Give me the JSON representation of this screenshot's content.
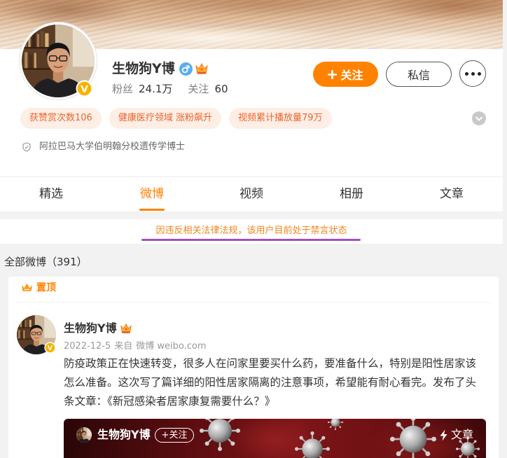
{
  "colors": {
    "accent": "#ff8200",
    "tag_bg": "#fdeee6",
    "tag_text": "#e9662c",
    "notice_text": "#f0861e",
    "annotation": "#a24fbf",
    "male_icon": "#5aaef0",
    "verified": "#f6b400",
    "page_bg": "#f2f2f2"
  },
  "profile": {
    "name": "生物狗Y博",
    "gender_icon": "male-icon",
    "member_icon": "crown-icon",
    "verified_icon": "verified-v-icon",
    "fans_label": "粉丝",
    "fans_count": "24.1万",
    "following_label": "关注",
    "following_count": "60",
    "tags": [
      "获赞赏次数106",
      "健康医疗领域 涨粉飙升",
      "视频累计播放量79万"
    ],
    "expand_icon": "chevron-down-icon",
    "description_icon": "shield-icon",
    "description": "阿拉巴马大学伯明翰分校遗传学博士"
  },
  "actions": {
    "follow_icon": "plus-icon",
    "follow_label": "关注",
    "message_label": "私信",
    "more_icon": "more-dots-icon"
  },
  "tabs": [
    {
      "label": "精选",
      "active": false
    },
    {
      "label": "微博",
      "active": true
    },
    {
      "label": "视频",
      "active": false
    },
    {
      "label": "相册",
      "active": false
    },
    {
      "label": "文章",
      "active": false
    }
  ],
  "notice": "因违反相关法律法规，该用户目前处于禁言状态",
  "feed": {
    "header": "全部微博（391）",
    "pinned_icon": "crown-icon",
    "pinned_label": "置顶",
    "post": {
      "author": "生物狗Y博",
      "member_icon": "crown-icon",
      "date": "2022-12-5",
      "source_prefix": "来自",
      "source": "微博 weibo.com",
      "text": "防疫政策正在快速转变，很多人在问家里要买什么药，要准备什么，特别是阳性居家该怎么准备。这次写了篇详细的阳性居家隔离的注意事项，希望能有耐心看完。发布了头条文章：《新冠感染者居家康复需要什么？》",
      "article_card": {
        "author": "生物狗Y博",
        "follow_label": "+关注",
        "type_icon": "lightning-icon",
        "type_label": "文章"
      }
    }
  }
}
